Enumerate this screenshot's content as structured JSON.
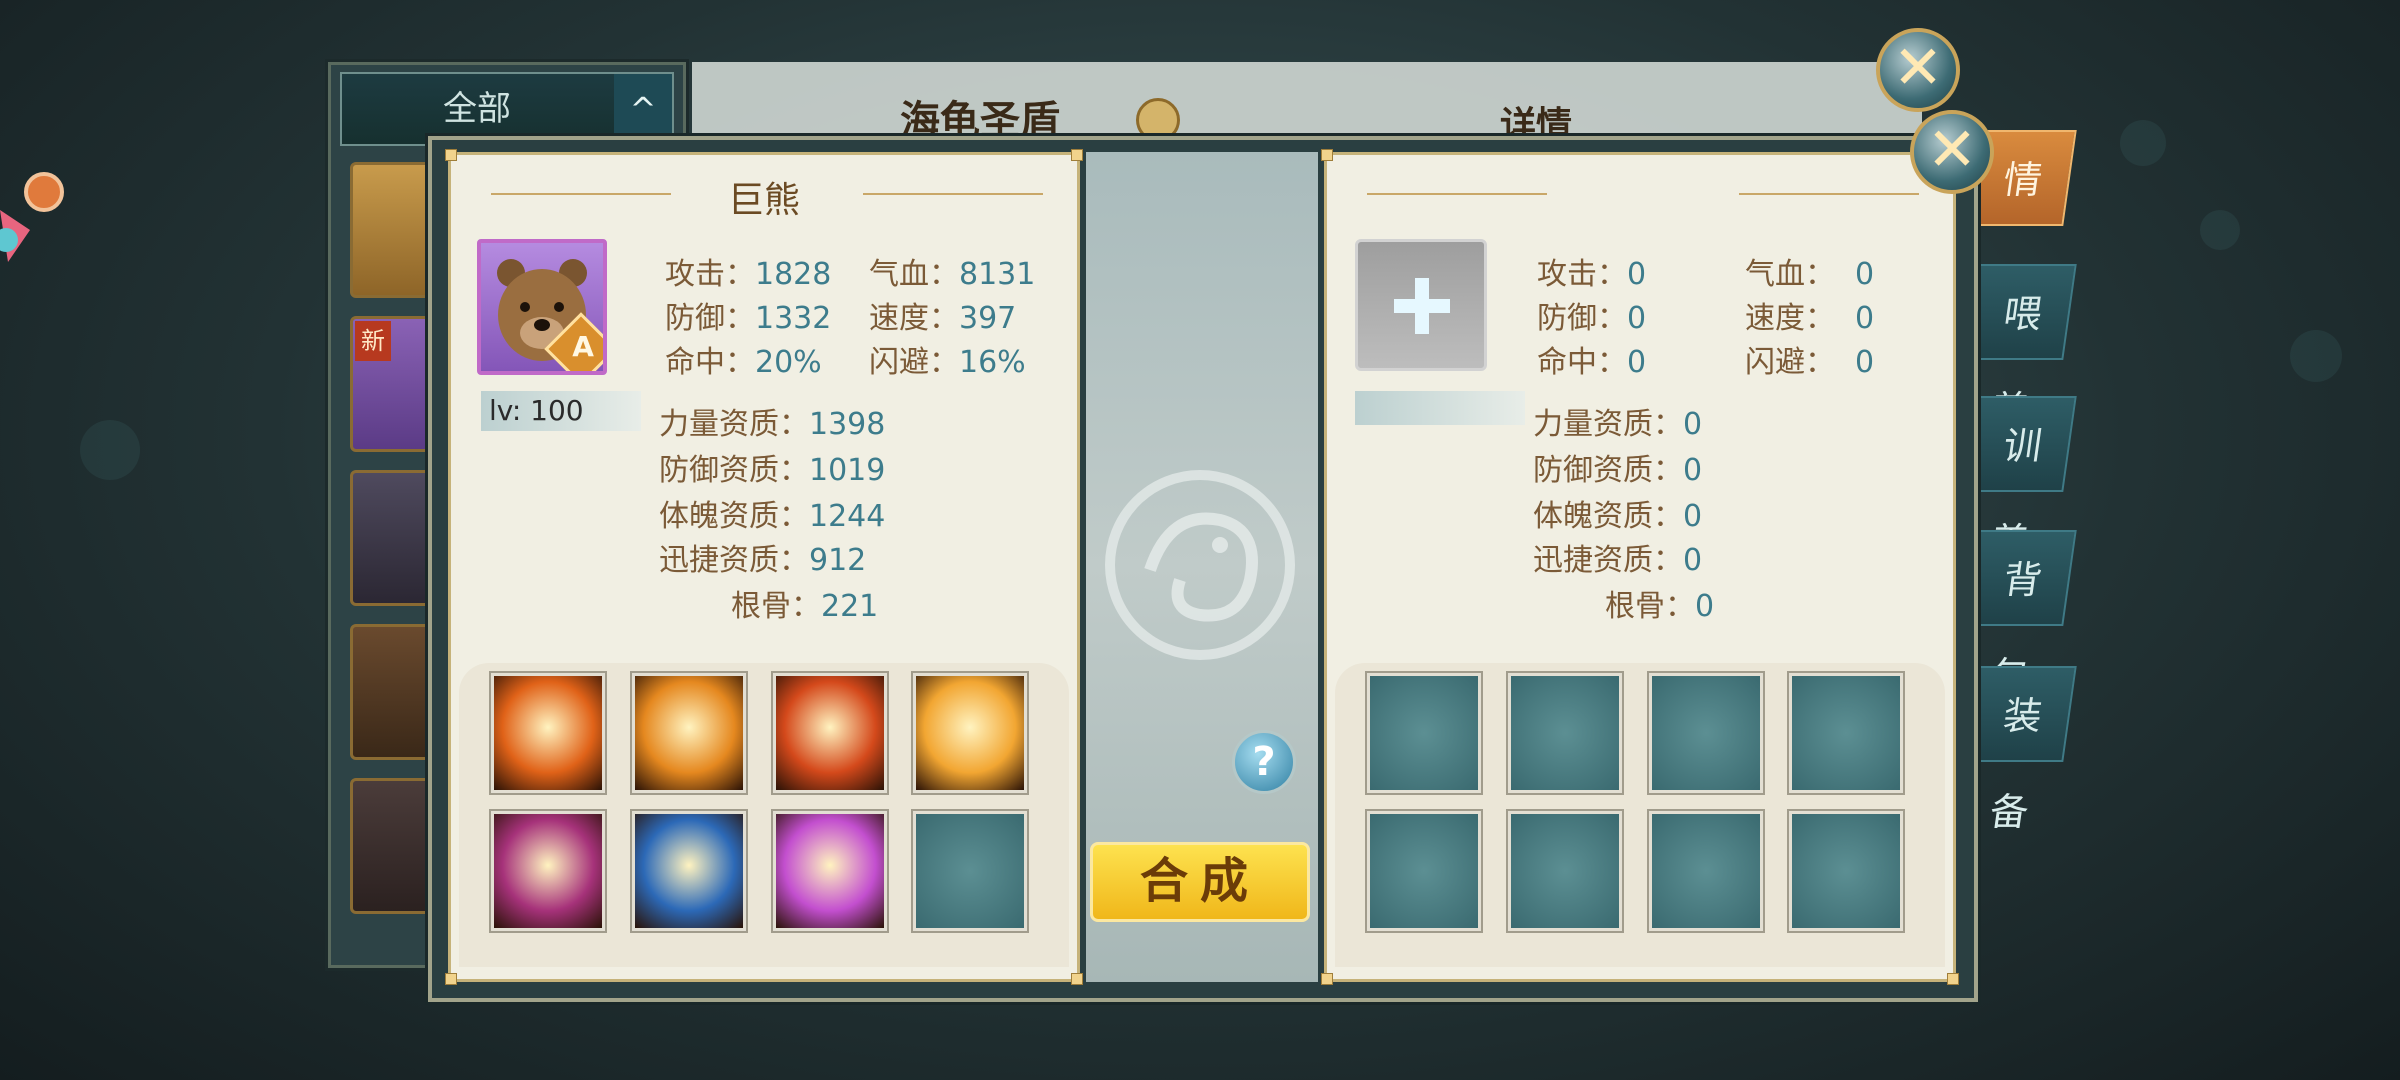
{
  "back_panel": {
    "filter_label": "全部",
    "filter_arrow": "^",
    "list_badge_new": "新",
    "pet_name": "海龟圣盾",
    "detail_title": "详情",
    "side_tabs": [
      "情",
      "喂 养",
      "训 养",
      "背 包",
      "装 备"
    ]
  },
  "close_symbol": "✕",
  "left_card": {
    "name": "巨熊",
    "grade": "A",
    "level": "lv: 100",
    "stats": {
      "attack_label": "攻击：",
      "attack": "1828",
      "hp_label": "气血：",
      "hp": "8131",
      "defense_label": "防御：",
      "defense": "1332",
      "speed_label": "速度：",
      "speed": "397",
      "hit_label": "命中：",
      "hit": "20%",
      "dodge_label": "闪避：",
      "dodge": "16%"
    },
    "aptitudes": {
      "strength_label": "力量资质：",
      "strength": "1398",
      "defense_label": "防御资质：",
      "defense": "1019",
      "physique_label": "体魄资质：",
      "physique": "1244",
      "agility_label": "迅捷资质：",
      "agility": "912",
      "root_label": "根骨：",
      "root": "221"
    },
    "skills": [
      {
        "icon": "flame-shield-icon",
        "color": "#e06218"
      },
      {
        "icon": "fire-tiger-icon",
        "color": "#e5881f"
      },
      {
        "icon": "phoenix-icon",
        "color": "#d4491b"
      },
      {
        "icon": "light-burst-icon",
        "color": "#f2a632"
      },
      {
        "icon": "purple-claw-icon",
        "color": "#a6327a"
      },
      {
        "icon": "blue-strike-icon",
        "color": "#2c69b7"
      },
      {
        "icon": "pink-orb-icon",
        "color": "#c34fcf"
      },
      {
        "icon": "empty-slot-icon",
        "color": "#4d8186"
      }
    ]
  },
  "right_card": {
    "add_symbol": "+",
    "stats": {
      "attack_label": "攻击：",
      "attack": "0",
      "hp_label": "气血：",
      "hp": "0",
      "defense_label": "防御：",
      "defense": "0",
      "speed_label": "速度：",
      "speed": "0",
      "hit_label": "命中：",
      "hit": "0",
      "dodge_label": "闪避：",
      "dodge": "0"
    },
    "aptitudes": {
      "strength_label": "力量资质：",
      "strength": "0",
      "defense_label": "防御资质：",
      "defense": "0",
      "physique_label": "体魄资质：",
      "physique": "0",
      "agility_label": "迅捷资质：",
      "agility": "0",
      "root_label": "根骨：",
      "root": "0"
    }
  },
  "help_label": "?",
  "synthesize_label": "合成",
  "colors": {
    "accent_gold": "#f0b71a",
    "text_brown": "#7b5a37",
    "value_teal": "#3d7c8c"
  }
}
